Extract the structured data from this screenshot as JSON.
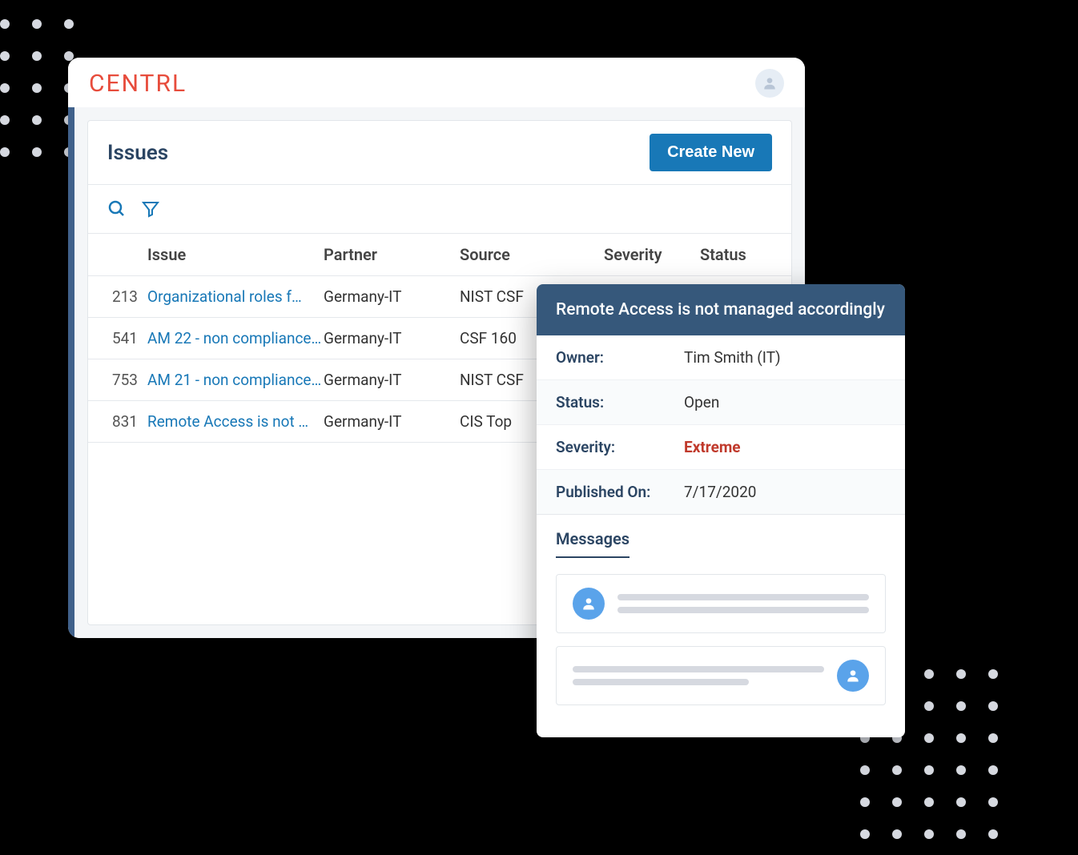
{
  "app": {
    "brand": "CENTRL"
  },
  "panel": {
    "title": "Issues",
    "create_button": "Create New"
  },
  "columns": {
    "id": "",
    "issue": "Issue",
    "partner": "Partner",
    "source": "Source",
    "severity": "Severity",
    "status": "Status"
  },
  "rows": [
    {
      "id": "213",
      "issue": "Organizational roles f…",
      "partner": "Germany-IT",
      "source": "NIST CSF"
    },
    {
      "id": "541",
      "issue": "AM 22 - non compliance…",
      "partner": "Germany-IT",
      "source": "CSF 160"
    },
    {
      "id": "753",
      "issue": "AM 21 - non compliance…",
      "partner": "Germany-IT",
      "source": "NIST CSF"
    },
    {
      "id": "831",
      "issue": "Remote Access is not …",
      "partner": "Germany-IT",
      "source": "CIS Top"
    }
  ],
  "detail": {
    "title": "Remote Access is not managed accordingly",
    "owner_label": "Owner:",
    "owner_value": "Tim Smith (IT)",
    "status_label": "Status:",
    "status_value": "Open",
    "severity_label": "Severity:",
    "severity_value": "Extreme",
    "published_label": "Published On:",
    "published_value": "7/17/2020",
    "messages_heading": "Messages"
  }
}
